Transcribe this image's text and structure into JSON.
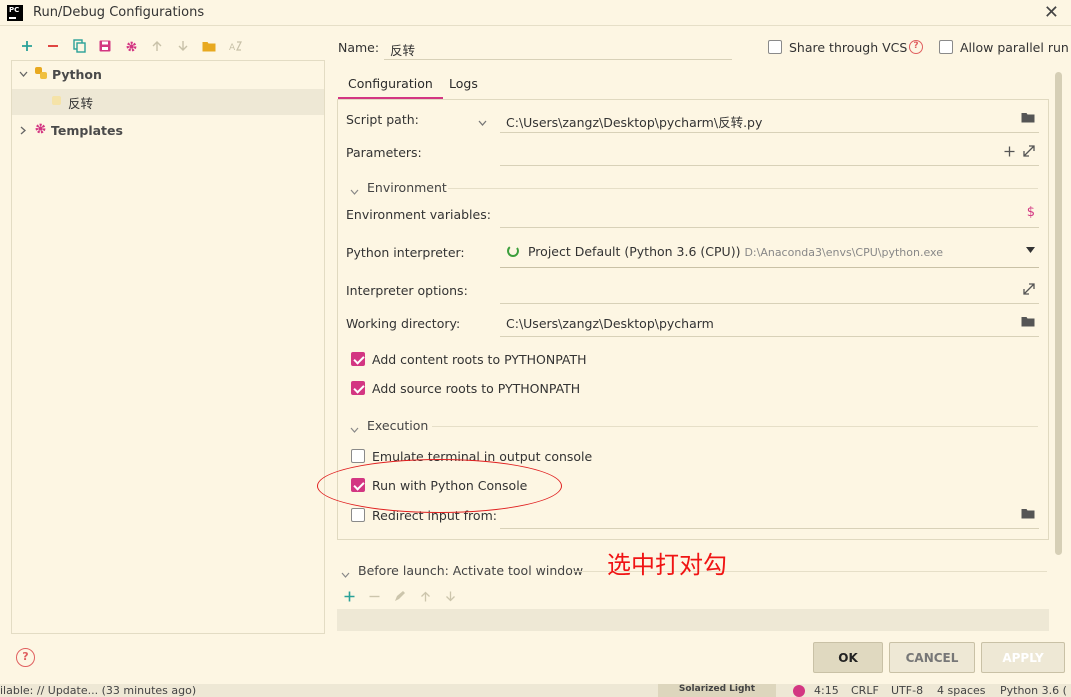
{
  "window": {
    "title": "Run/Debug Configurations",
    "app_logo_text": "PC"
  },
  "tree": {
    "python_label": "Python",
    "config_label": "反转",
    "templates_label": "Templates"
  },
  "header": {
    "name_label": "Name:",
    "name_value": "反转",
    "share_vcs_label": "Share through VCS",
    "share_vcs_checked": false,
    "allow_parallel_label": "Allow parallel run",
    "allow_parallel_checked": false
  },
  "tabs": [
    {
      "label": "Configuration",
      "active": true
    },
    {
      "label": "Logs",
      "active": false
    }
  ],
  "config": {
    "script_path_label": "Script path:",
    "script_path_value": "C:\\Users\\zangz\\Desktop\\pycharm\\反转.py",
    "parameters_label": "Parameters:",
    "parameters_value": "",
    "environment_section": "Environment",
    "env_vars_label": "Environment variables:",
    "env_vars_value": "",
    "interpreter_label": "Python interpreter:",
    "interpreter_name": "Project Default (Python 3.6 (CPU))",
    "interpreter_path": "D:\\Anaconda3\\envs\\CPU\\python.exe",
    "interp_options_label": "Interpreter options:",
    "interp_options_value": "",
    "working_dir_label": "Working directory:",
    "working_dir_value": "C:\\Users\\zangz\\Desktop\\pycharm",
    "add_content_roots_label": "Add content roots to PYTHONPATH",
    "add_content_roots_checked": true,
    "add_source_roots_label": "Add source roots to PYTHONPATH",
    "add_source_roots_checked": true,
    "execution_section": "Execution",
    "emulate_terminal_label": "Emulate terminal in output console",
    "emulate_terminal_checked": false,
    "run_python_console_label": "Run with Python Console",
    "run_python_console_checked": true,
    "redirect_input_label": "Redirect input from:",
    "redirect_input_checked": false,
    "redirect_input_value": ""
  },
  "before_launch": {
    "label": "Before launch: Activate tool window"
  },
  "buttons": {
    "ok": "OK",
    "cancel": "CANCEL",
    "apply": "APPLY"
  },
  "statusbar": {
    "left_text": "ilable: // Update... (33 minutes ago)",
    "theme": "Solarized Light",
    "position": "4:15",
    "line_sep": "CRLF",
    "encoding": "UTF-8",
    "indent": "4 spaces",
    "interpreter": "Python 3.6 ("
  },
  "annotation": {
    "text": "选中打对勾"
  },
  "colors": {
    "background": "#fdf6e3",
    "accent": "#d33682",
    "annotation_red": "#f01414",
    "selection": "#eee8d5"
  }
}
